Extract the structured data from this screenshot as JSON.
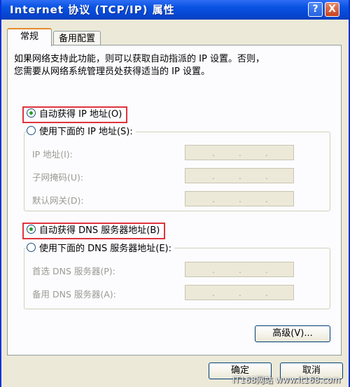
{
  "window": {
    "title": "Internet 协议 (TCP/IP) 属性",
    "help_label": "?",
    "close_label": "X"
  },
  "tabs": [
    {
      "label": "常规",
      "active": true
    },
    {
      "label": "备用配置",
      "active": false
    }
  ],
  "description": {
    "line1": "如果网络支持此功能，则可以获取自动指派的 IP 设置。否则，",
    "line2": "您需要从网络系统管理员处获得适当的 IP 设置。"
  },
  "ip_section": {
    "auto_label": "自动获得 IP 地址(O)",
    "auto_selected": true,
    "manual_label": "使用下面的 IP 地址(S):",
    "fields": [
      {
        "label": "IP 地址(I):",
        "value": ""
      },
      {
        "label": "子网掩码(U):",
        "value": ""
      },
      {
        "label": "默认网关(D):",
        "value": ""
      }
    ]
  },
  "dns_section": {
    "auto_label": "自动获得 DNS 服务器地址(B)",
    "auto_selected": true,
    "manual_label": "使用下面的 DNS 服务器地址(E):",
    "fields": [
      {
        "label": "首选 DNS 服务器(P):",
        "value": ""
      },
      {
        "label": "备用 DNS 服务器(A):",
        "value": ""
      }
    ]
  },
  "buttons": {
    "advanced": "高级(V)...",
    "ok": "确定",
    "cancel": "取消"
  },
  "watermark": "IT168网站 www.it168.com",
  "colors": {
    "titlebar": "#0a54e3",
    "highlight_border": "#e0343e",
    "active_tab_accent": "#e68b2c"
  }
}
